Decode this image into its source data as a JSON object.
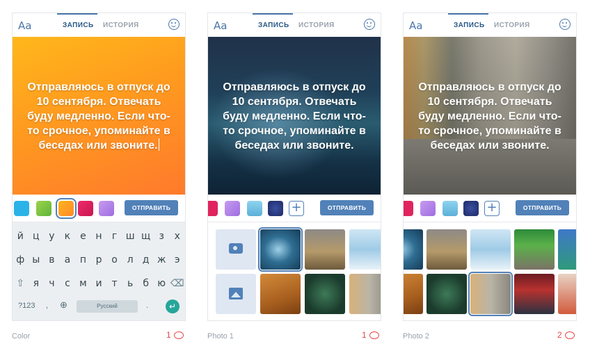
{
  "common": {
    "aa_label": "Aa",
    "tab_record": "ЗАПИСЬ",
    "tab_history": "ИСТОРИЯ",
    "send_label": "ОТПРАВИТЬ",
    "story_text": "Отправляюсь в отпуск до 10 сентября. Отвечать буду медленно. Если что-то срочное, упоминайте в беседах или звоните.",
    "smile_icon": "smile-icon",
    "plus_label": "+"
  },
  "keyboard": {
    "row1": [
      "й",
      "ц",
      "у",
      "к",
      "е",
      "н",
      "г",
      "ш",
      "щ",
      "з",
      "х"
    ],
    "row2": [
      "ф",
      "ы",
      "в",
      "а",
      "п",
      "р",
      "о",
      "л",
      "д",
      "ж",
      "э"
    ],
    "row3": [
      "я",
      "ч",
      "с",
      "м",
      "и",
      "т",
      "ь",
      "б",
      "ю"
    ],
    "sym_label": "?123",
    "comma_label": ",",
    "space_label": "Русский",
    "period_label": ".",
    "shift_icon": "shift-icon",
    "backspace_icon": "backspace-icon",
    "globe_icon": "globe-icon",
    "enter_icon": "enter-icon"
  },
  "swatches_color": [
    "#2bb3e8",
    "#7cc63f",
    "#ff9e2a",
    "#e0245e",
    "#b57ee8"
  ],
  "panels": [
    {
      "caption": "Color",
      "likes": "1"
    },
    {
      "caption": "Photo 1",
      "likes": "1"
    },
    {
      "caption": "Photo 2",
      "likes": "2"
    }
  ]
}
